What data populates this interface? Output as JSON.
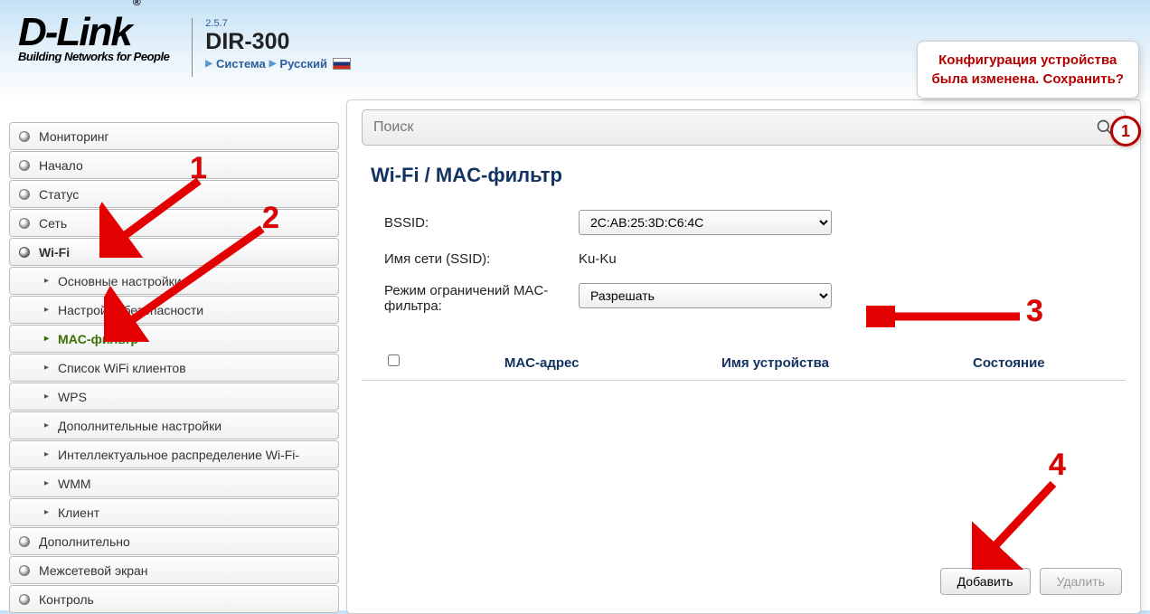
{
  "header": {
    "logo_text": "D-Link",
    "logo_tagline": "Building Networks for People",
    "version": "2.5.7",
    "model": "DIR-300",
    "crumb_system": "Система",
    "crumb_lang": "Русский"
  },
  "notification": {
    "line1": "Конфигурация устройства",
    "line2": "была изменена. Сохранить?",
    "count": "1"
  },
  "sidebar": {
    "items": [
      {
        "label": "Мониторинг"
      },
      {
        "label": "Начало"
      },
      {
        "label": "Статус"
      },
      {
        "label": "Сеть"
      },
      {
        "label": "Wi-Fi"
      },
      {
        "label": "Дополнительно"
      },
      {
        "label": "Межсетевой экран"
      },
      {
        "label": "Контроль"
      }
    ],
    "wifi_sub": [
      {
        "label": "Основные настройки"
      },
      {
        "label": "Настройки безопасности"
      },
      {
        "label": "MAC-фильтр"
      },
      {
        "label": "Список WiFi клиентов"
      },
      {
        "label": "WPS"
      },
      {
        "label": "Дополнительные настройки"
      },
      {
        "label": "Интеллектуальное распределение Wi-Fi-"
      },
      {
        "label": "WMM"
      },
      {
        "label": "Клиент"
      }
    ]
  },
  "search": {
    "placeholder": "Поиск"
  },
  "page": {
    "title": "Wi-Fi / MAC-фильтр",
    "bssid_label": "BSSID:",
    "bssid_value": "2C:AB:25:3D:C6:4C",
    "ssid_label": "Имя сети (SSID):",
    "ssid_value": "Ku-Ku",
    "mode_label": "Режим ограничений MAC-фильтра:",
    "mode_value": "Разрешать",
    "table": {
      "col_mac": "MAC-адрес",
      "col_name": "Имя устройства",
      "col_state": "Состояние"
    },
    "buttons": {
      "add": "Добавить",
      "delete": "Удалить"
    }
  },
  "annotations": {
    "n1": "1",
    "n2": "2",
    "n3": "3",
    "n4": "4"
  }
}
